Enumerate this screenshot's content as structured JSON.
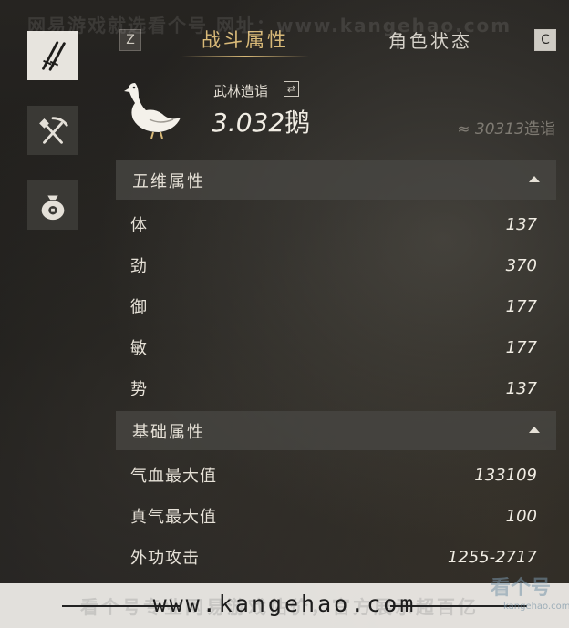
{
  "watermark": {
    "top_text": "网易游戏就选看个号  网址：www.kangehao.com",
    "bottom_faint_text": "看个号专业网易游戏估价，官方展示超百亿",
    "bottom_url": "www.kangehao.com",
    "logo_text": "看个号",
    "logo_sub": "kangehao.com"
  },
  "sidebar": {
    "items": [
      {
        "icon": "crossed-swords-icon",
        "active": true
      },
      {
        "icon": "pickaxe-shovel-icon",
        "active": false
      },
      {
        "icon": "money-bag-icon",
        "active": false
      }
    ]
  },
  "tabs": {
    "left_key": "Z",
    "right_key": "C",
    "active_label": "战斗属性",
    "inactive_label": "角色状态"
  },
  "rank": {
    "label": "武林造诣",
    "swap_icon": "⇄",
    "value": "3.032",
    "unit": "鹅",
    "equiv_prefix": "≈",
    "equiv_value": "30313",
    "equiv_unit": "造诣"
  },
  "sections": {
    "five_dims": {
      "title": "五维属性",
      "rows": [
        {
          "label": "体",
          "value": "137"
        },
        {
          "label": "劲",
          "value": "370"
        },
        {
          "label": "御",
          "value": "177"
        },
        {
          "label": "敏",
          "value": "177"
        },
        {
          "label": "势",
          "value": "137"
        }
      ]
    },
    "basic": {
      "title": "基础属性",
      "rows": [
        {
          "label": "气血最大值",
          "value": "133109"
        },
        {
          "label": "真气最大值",
          "value": "100"
        },
        {
          "label": "外功攻击",
          "value": "1255-2717"
        }
      ]
    }
  },
  "colors": {
    "accent_gold": "#d8b978",
    "panel_header": "#484642",
    "text_primary": "#e6e1d7",
    "text_muted": "#7f7b73"
  }
}
